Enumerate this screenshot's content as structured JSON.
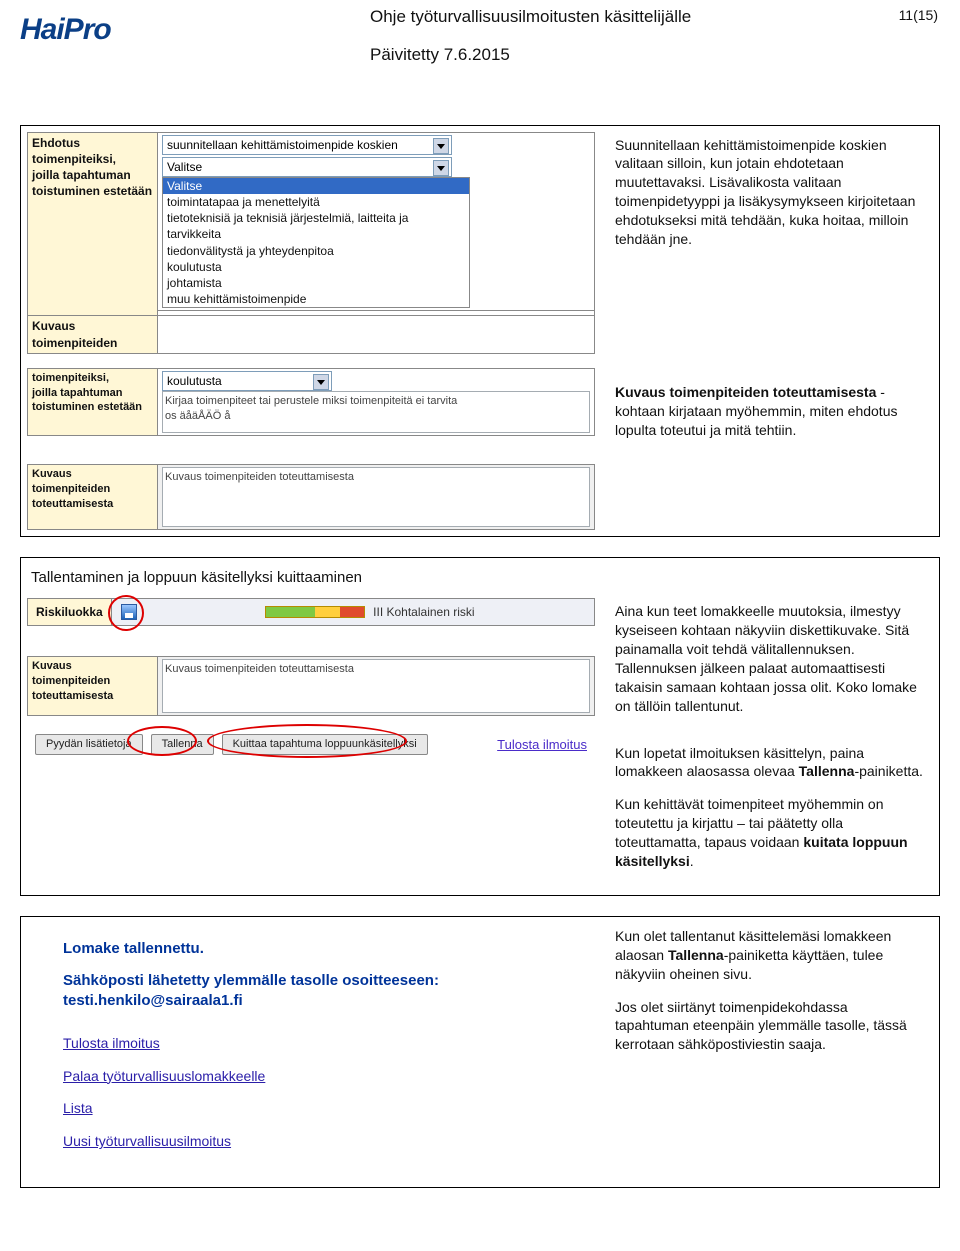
{
  "header": {
    "logo": "HaiPro",
    "title": "Ohje työturvallisuusilmoitusten käsittelijälle",
    "page_no": "11(15)",
    "updated": "Päivitetty 7.6.2015"
  },
  "box1": {
    "form": {
      "row1_label_a": "Ehdotus",
      "row1_label_b": "toimenpiteiksi,",
      "row1_label_c": "joilla tapahtuman",
      "row1_label_d": "toistuminen estetään",
      "ddl_plan": "suunnitellaan kehittämistoimenpide koskien",
      "ddl_sel": "Valitse",
      "options": [
        "Valitse",
        "toimintatapaa ja menettelyitä",
        "tietoteknisiä ja teknisiä järjestelmiä, laitteita ja tarvikkeita",
        "tiedonvälitystä ja yhteydenpitoa",
        "koulutusta",
        "johtamista",
        "muu kehittämistoimenpide"
      ],
      "row2_label_a": "Kuvaus",
      "row2_label_b": "toimenpiteiden"
    },
    "form2": {
      "label_a": "toimenpiteiksi,",
      "label_b": "joilla tapahtuman",
      "label_c": "toistuminen estetään",
      "ddl": "koulutusta",
      "placeholder_a": "Kirjaa toimenpiteet tai perustele miksi toimenpiteitä ei tarvita",
      "placeholder_b": "os  äåäÅÄÖ  å"
    },
    "form3": {
      "label_a": "Kuvaus",
      "label_b": "toimenpiteiden",
      "label_c": "toteuttamisesta",
      "placeholder": "Kuvaus toimenpiteiden toteuttamisesta"
    },
    "right_p1": "Suunnitellaan kehittämistoimenpide koskien valitaan silloin, kun jotain ehdotetaan muutettavaksi. Lisävalikosta valitaan toimenpidetyyppi ja lisäkysymykseen kirjoitetaan ehdotukseksi mitä tehdään, kuka hoitaa, milloin tehdään jne.",
    "right_p2_a": "Kuvaus toimenpiteiden toteuttamisesta ",
    "right_p2_b": "- kohtaan kirjataan myöhemmin, miten ehdotus lopulta toteutui ja mitä tehtiin."
  },
  "box2": {
    "heading": "Tallentaminen ja loppuun käsitellyksi kuittaaminen",
    "risk": {
      "label": "Riskiluokka",
      "text": "III Kohtalainen riski"
    },
    "form3": {
      "label_a": "Kuvaus",
      "label_b": "toimenpiteiden",
      "label_c": "toteuttamisesta",
      "placeholder": "Kuvaus toimenpiteiden toteuttamisesta"
    },
    "buttons": {
      "b1": "Pyydän lisätietoja",
      "b2": "Tallenna",
      "b3": "Kuittaa tapahtuma loppuunkäsitellyksi",
      "print": "Tulosta ilmoitus"
    },
    "right_p1": "Aina kun teet lomakkeelle muutoksia, ilmestyy kyseiseen kohtaan näkyviin diskettikuvake. Sitä painamalla voit tehdä välitallennuksen. Tallennuksen jälkeen palaat automaattisesti takaisin samaan kohtaan jossa olit. Koko lomake on tällöin tallentunut.",
    "right_p2_a": "Kun lopetat ilmoituksen käsittelyn, paina lomakkeen alaosassa olevaa ",
    "right_p2_b": "Tallenna",
    "right_p2_c": "-painiketta.",
    "right_p3_a": "Kun kehittävät toimenpiteet myöhemmin on toteutettu ja kirjattu – tai päätetty olla toteuttamatta, tapaus voidaan ",
    "right_p3_b": "kuitata loppuun käsitellyksi",
    "right_p3_c": "."
  },
  "box3": {
    "saved": "Lomake tallennettu.",
    "email": "Sähköposti lähetetty ylemmälle tasolle osoitteeseen: testi.henkilo@sairaala1.fi",
    "links": {
      "l1": "Tulosta ilmoitus",
      "l2": "Palaa työturvallisuuslomakkeelle",
      "l3": "Lista",
      "l4": "Uusi työturvallisuusilmoitus"
    },
    "right_p1_a": "Kun olet tallentanut käsittelemäsi lomakkeen alaosan ",
    "right_p1_b": "Tallenna",
    "right_p1_c": "-painiketta käyttäen, tulee näkyviin oheinen sivu.",
    "right_p2": "Jos olet siirtänyt toimenpidekohdassa tapahtuman eteenpäin ylemmälle tasolle, tässä kerrotaan sähköpostiviestin saaja."
  }
}
